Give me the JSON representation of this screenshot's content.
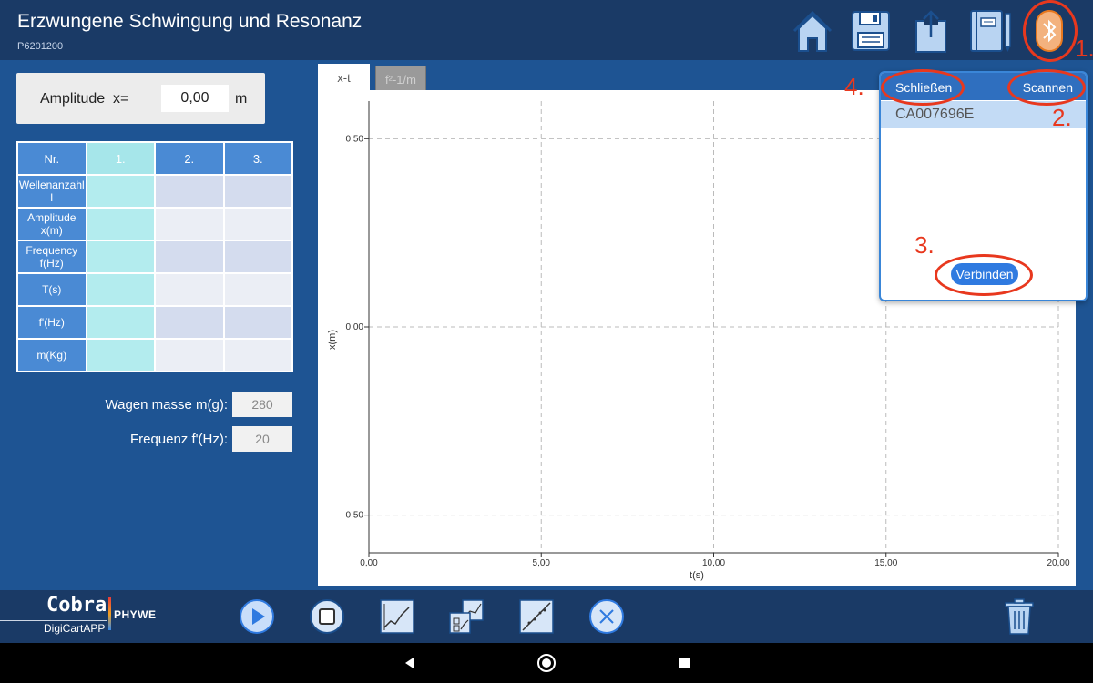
{
  "header": {
    "title": "Erzwungene Schwingung und Resonanz",
    "subtitle": "P6201200",
    "icons": [
      "home-icon",
      "save-icon",
      "share-icon",
      "notebook-icon",
      "bluetooth-icon"
    ]
  },
  "amplitude": {
    "label": "Amplitude  x=",
    "value": "0,00",
    "unit": "m"
  },
  "table": {
    "headers": [
      "Nr.",
      "1.",
      "2.",
      "3."
    ],
    "rows": [
      {
        "label": "Wellenanzahl\nl",
        "values": [
          "",
          "",
          ""
        ]
      },
      {
        "label": "Amplitude\nx(m)",
        "values": [
          "",
          "",
          ""
        ]
      },
      {
        "label": "Frequency\nf(Hz)",
        "values": [
          "",
          "",
          ""
        ]
      },
      {
        "label": "T(s)",
        "values": [
          "",
          "",
          ""
        ]
      },
      {
        "label": "f'(Hz)",
        "values": [
          "",
          "",
          ""
        ]
      },
      {
        "label": "m(Kg)",
        "values": [
          "",
          "",
          ""
        ]
      }
    ]
  },
  "fields": {
    "mass_label": "Wagen masse m(g):",
    "mass_value": "280",
    "freq_label": "Frequenz f'(Hz):",
    "freq_value": "20"
  },
  "tabs": {
    "active": "x-t",
    "inactive": "f²-1/m"
  },
  "chart_data": {
    "type": "line",
    "xlabel": "t(s)",
    "ylabel": "x(m)",
    "xlim": [
      0,
      20
    ],
    "ylim": [
      -0.6,
      0.6
    ],
    "x_ticks": [
      "0,00",
      "5,00",
      "10,00",
      "15,00",
      "20,00"
    ],
    "y_ticks": [
      "0,50",
      "0,00",
      "-0,50"
    ],
    "grid": true,
    "series": []
  },
  "bluetooth": {
    "close_label": "Schließen",
    "scan_label": "Scannen",
    "device": "CA007696E",
    "connect_label": "Verbinden"
  },
  "annotations": {
    "n1": "1.",
    "n2": "2.",
    "n3": "3.",
    "n4": "4.",
    "color": "#e8381e"
  },
  "footer": {
    "logo_main": "Cobra",
    "logo_sub": "DigiCartAPP",
    "logo_brand": "PHYWE"
  },
  "colors": {
    "header_bg": "#1a3a66",
    "main_bg": "#1e5493",
    "accent": "#2f6fbf"
  }
}
